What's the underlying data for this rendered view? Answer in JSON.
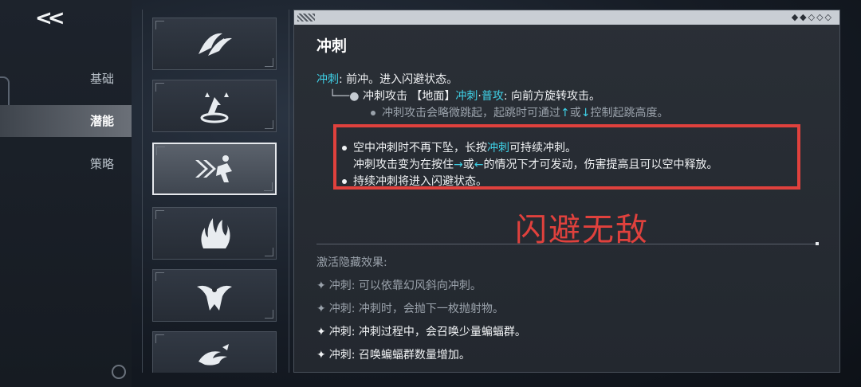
{
  "nav": {
    "back_label": "<<",
    "tabs": [
      {
        "label": "基础",
        "active": false
      },
      {
        "label": "潜能",
        "active": true
      },
      {
        "label": "策略",
        "active": false
      }
    ]
  },
  "abilities": [
    {
      "icon": "wing-slash-icon",
      "selected": false
    },
    {
      "icon": "leap-icon",
      "selected": false
    },
    {
      "icon": "dash-runner-icon",
      "selected": true
    },
    {
      "icon": "flame-pillar-icon",
      "selected": false
    },
    {
      "icon": "bat-emblem-icon",
      "selected": false
    },
    {
      "icon": "swirl-wind-icon",
      "selected": false
    }
  ],
  "detail": {
    "title": "冲刺",
    "intro_term": "冲刺",
    "intro_text": ": 前冲。进入闪避状态。",
    "combo_prefix": "冲刺攻击 【地面】",
    "combo_term1": "冲刺",
    "combo_sep": "·",
    "combo_term2": "普攻",
    "combo_text": ": 向前方旋转攻击。",
    "jump_text_a": "冲刺攻击会略微跳起，起跳时可通过",
    "jump_arrow_up": "↑",
    "jump_or": "或",
    "jump_arrow_down": "↓",
    "jump_text_b": "控制起跳高度。",
    "air_text_a": "空中冲刺时不再下坠，长按",
    "air_term": "冲刺",
    "air_text_b": "可持续冲刺。",
    "dir_text_a": "冲刺攻击变为在按住",
    "dir_arrow_right": "→",
    "dir_or": "或",
    "dir_arrow_left": "←",
    "dir_text_b": "的情况下才可发动，伤害提高且可以空中释放。",
    "hold_text": "持续冲刺将进入闪避状态。",
    "hidden_header": "激活隐藏效果:",
    "hidden_effects": [
      {
        "text": "冲刺: 可以依靠幻风斜向冲刺。",
        "active": false
      },
      {
        "text": "冲刺: 冲刺时，会抛下一枚抛射物。",
        "active": false
      },
      {
        "text": "冲刺: 冲刺过程中，会召唤少量蝙蝠群。",
        "active": true
      },
      {
        "text": "冲刺: 召唤蝙蝠群数量增加。",
        "active": true
      }
    ]
  },
  "annotation": {
    "caption": "闪避无敌",
    "color": "#e0413d"
  },
  "colors": {
    "accent_cyan": "#3fd2e8",
    "panel_bg": "#2a2f36",
    "highlight_red": "#e0413d"
  }
}
